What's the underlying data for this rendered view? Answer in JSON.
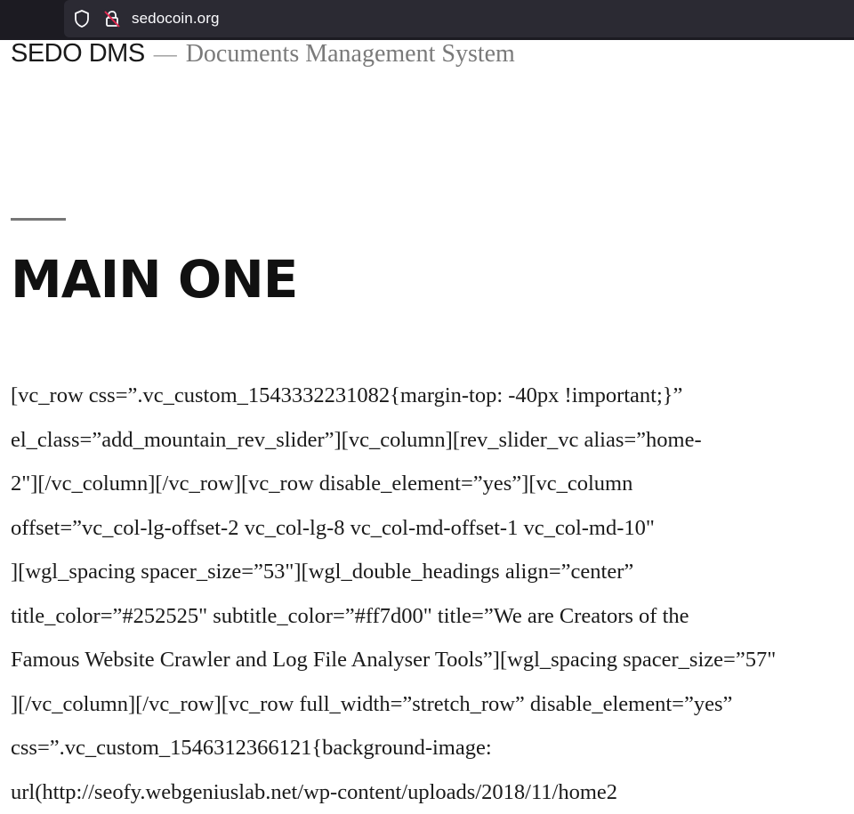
{
  "browser": {
    "url": "sedocoin.org",
    "icons": [
      "shield-icon",
      "lock-slash-icon"
    ]
  },
  "site": {
    "title": "SEDO DMS",
    "separator": "—",
    "description": "Documents Management System"
  },
  "page": {
    "title": "MAIN ONE",
    "content_lines": [
      "[vc_row css=”.vc_custom_1543332231082{margin-top: -40px !important;}”",
      "el_class=”add_mountain_rev_slider”][vc_column][rev_slider_vc alias=”home-",
      "2\"][/vc_column][/vc_row][vc_row disable_element=”yes”][vc_column",
      "offset=”vc_col-lg-offset-2 vc_col-lg-8 vc_col-md-offset-1 vc_col-md-10\"",
      "][wgl_spacing spacer_size=”53\"][wgl_double_headings align=”center”",
      "title_color=”#252525\" subtitle_color=”#ff7d00\" title=”We are Creators of the",
      "Famous Website Crawler and Log File Analyser Tools”][wgl_spacing spacer_size=”57\"",
      "][/vc_column][/vc_row][vc_row full_width=”stretch_row” disable_element=”yes”",
      "css=”.vc_custom_1546312366121{background-image:",
      "url(http://seofy.webgeniuslab.net/wp-content/uploads/2018/11/home2"
    ]
  },
  "colors": {
    "browser_bar": "#1c1b22",
    "url_pill": "#2b2a33",
    "title_text": "#111111",
    "muted_text": "#7a7a7a"
  }
}
